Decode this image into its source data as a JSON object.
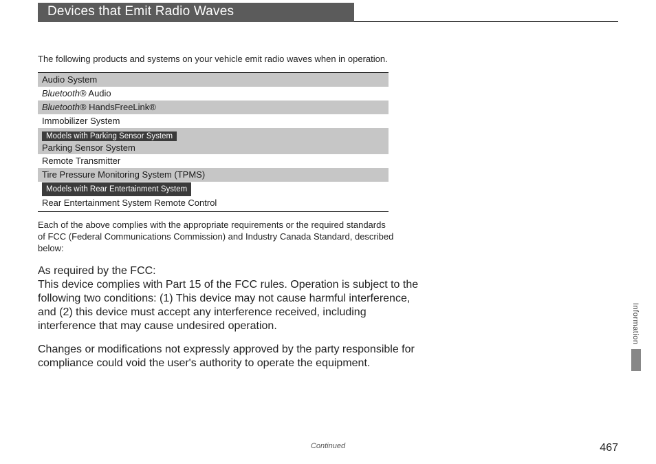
{
  "title": "Devices that Emit Radio Waves",
  "intro": "The following products and systems on your vehicle emit radio waves when in operation.",
  "table": {
    "r0": "Audio System",
    "r1_it": "Bluetooth",
    "r1_rest": "® Audio",
    "r2_it": "Bluetooth",
    "r2_rest": "® HandsFreeLink®",
    "r3": "Immobilizer System",
    "badge1": "Models with Parking Sensor System",
    "r4": "Parking Sensor System",
    "r5": "Remote Transmitter",
    "r6": "Tire Pressure Monitoring System (TPMS)",
    "badge2": "Models with Rear Entertainment System",
    "r7": "Rear Entertainment System Remote Control"
  },
  "compliance": "Each of the above complies with the appropriate requirements or the required standards of FCC (Federal Communications Commission) and Industry Canada Standard, described below:",
  "fcc_head": "As required by the FCC:",
  "fcc_body": "This device complies with Part 15 of the FCC rules. Operation is subject to the following two conditions: (1) This device may not cause harmful interference, and (2) this device must accept any interference received, including interference that may cause undesired operation.",
  "fcc_note": "Changes or modifications not expressly approved by the party responsible for compliance could void the user's authority to operate the equipment.",
  "side_label": "Information",
  "continued": "Continued",
  "page_num": "467"
}
